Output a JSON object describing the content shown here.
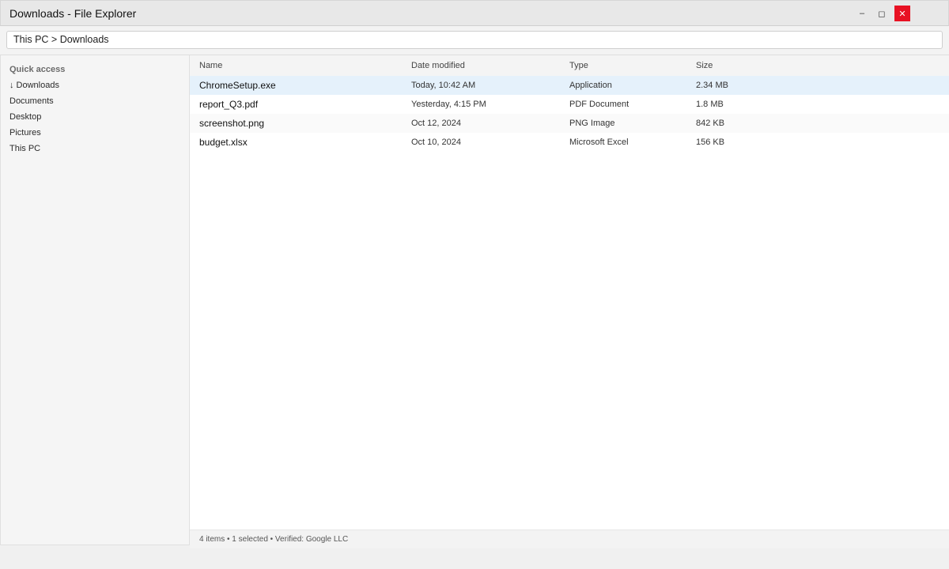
{
  "window": {
    "title": "Downloads - File Explorer",
    "minimize": "–",
    "maximize": "◻",
    "close": "✕",
    "close_color": "#e81123"
  },
  "address": {
    "path": "This PC > Downloads"
  },
  "sidebar": {
    "section": "Quick access",
    "items": [
      {
        "label": "↓ Downloads"
      },
      {
        "label": "Documents"
      },
      {
        "label": "Desktop"
      },
      {
        "label": "Pictures"
      },
      {
        "label": "This PC"
      }
    ]
  },
  "table": {
    "columns": [
      "Name",
      "Date modified",
      "Type",
      "Size"
    ],
    "rows": [
      {
        "name": "ChromeSetup.exe",
        "date": "Today, 10:42 AM",
        "type": "Application",
        "size": "2.34 MB",
        "selected": true
      },
      {
        "name": "report_Q3.pdf",
        "date": "Yesterday, 4:15 PM",
        "type": "PDF Document",
        "size": "1.8 MB"
      },
      {
        "name": "screenshot.png",
        "date": "Oct 12, 2024",
        "type": "PNG Image",
        "size": "842 KB"
      },
      {
        "name": "budget.xlsx",
        "date": "Oct 10, 2024",
        "type": "Microsoft Excel",
        "size": "156 KB"
      }
    ]
  },
  "status": {
    "text": "4 items • 1 selected • Verified: Google LLC"
  },
  "colors": {
    "selection": "#e5f1fb"
  }
}
